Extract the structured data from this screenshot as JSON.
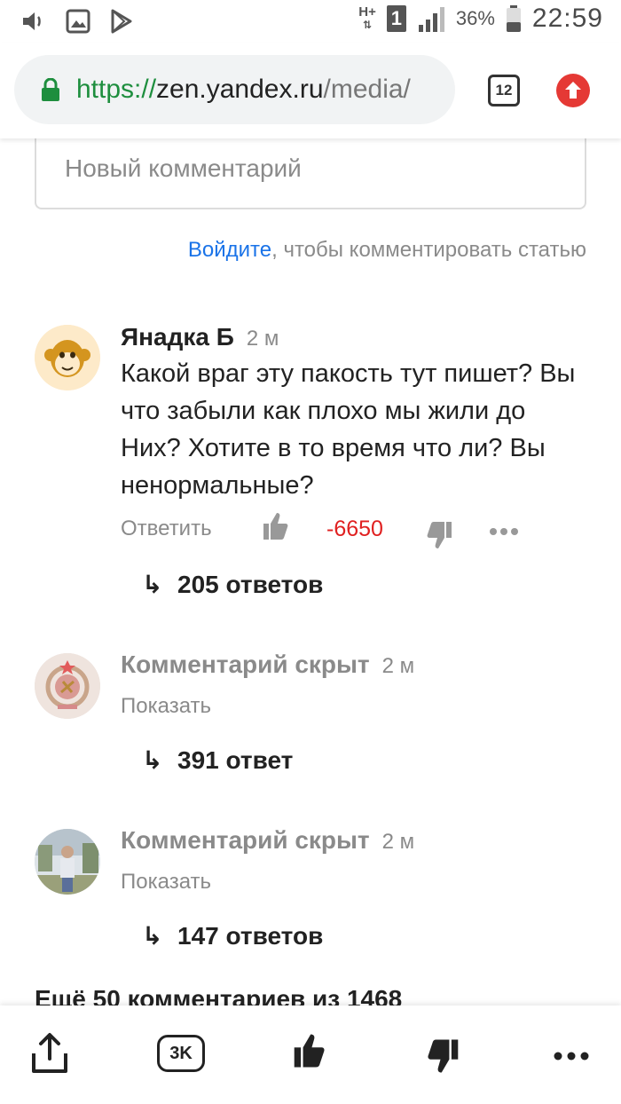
{
  "status_bar": {
    "network": "H+",
    "sim": "1",
    "battery": "36%",
    "time": "22:59"
  },
  "browser": {
    "url_scheme": "https://",
    "url_host": "zen.yandex.ru",
    "url_path": "/media/",
    "tab_count": "12"
  },
  "comment_form": {
    "placeholder": "Новый комментарий",
    "login_link": "Войдите",
    "login_rest": ", чтобы комментировать статью"
  },
  "comments": [
    {
      "author": "Янадка Б",
      "time": "2 м",
      "text": "Какой враг эту пакость тут пишет? Вы что забыли как плохо мы жили до Них? Хотите в то время что ли? Вы ненормальные?",
      "reply_label": "Ответить",
      "score": "-6650",
      "replies": "205 ответов"
    },
    {
      "title": "Комментарий скрыт",
      "time": "2 м",
      "show_label": "Показать",
      "replies": "391 ответ"
    },
    {
      "title": "Комментарий скрыт",
      "time": "2 м",
      "show_label": "Показать",
      "replies": "147 ответов"
    }
  ],
  "more_comments": "Ещё 50 комментариев из 1468",
  "bottom_bar": {
    "comments_badge": "3K"
  },
  "colors": {
    "link": "#1a73e8",
    "negative_score": "#e02020",
    "secure_green": "#1e8e3e",
    "update_red": "#e53935"
  }
}
